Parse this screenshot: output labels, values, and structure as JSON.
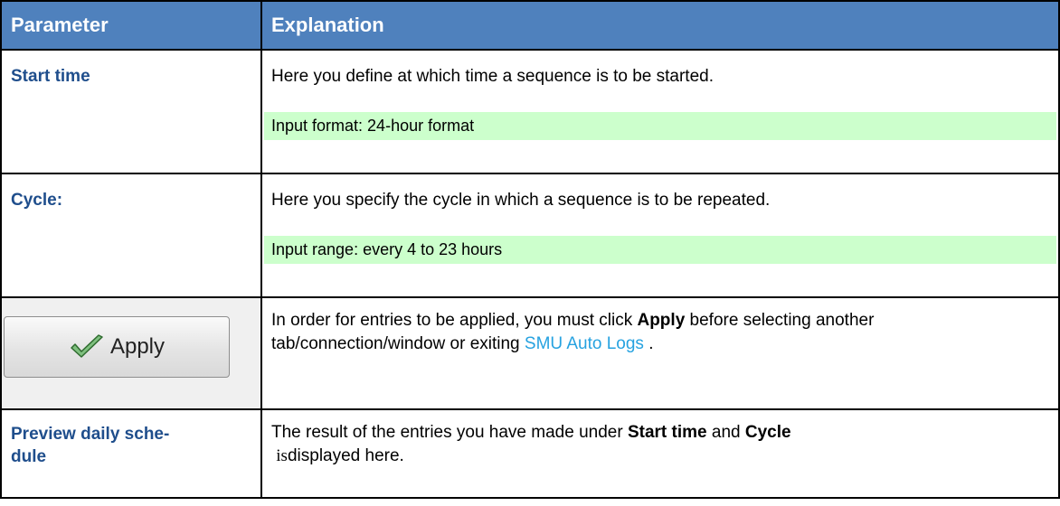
{
  "header": {
    "col1": "Parameter",
    "col2": "Explanation"
  },
  "rows": [
    {
      "param": "Start time",
      "text": "Here you define at which time a sequence is to be started.",
      "hint": "Input format: 24-hour format"
    },
    {
      "param": "Cycle:",
      "text": "Here you specify the cycle in which a sequence is to be repeated.",
      "hint": "Input range: every 4 to 23 hours"
    },
    {
      "button_label": "Apply",
      "button_icon": "checkmark-icon",
      "text_1": "In order for entries to be applied, you must click ",
      "text_bold": "Apply",
      "text_2": " before selecting another tab/connection/window or exiting ",
      "link": "SMU Auto Logs",
      "text_3": " ."
    },
    {
      "param": "Preview daily sche-dule",
      "param_line1": "Preview daily sche-",
      "param_line2": "dule",
      "text_1": "The result of the entries you have made under ",
      "bold_1": "Start time",
      "text_2": " and ",
      "bold_2": "Cycle",
      "text_3": "is",
      "text_4": "displayed here."
    }
  ],
  "colors": {
    "header_bg": "#4f81bd",
    "param_text": "#1f4e8c",
    "hint_bg": "#ccffcc",
    "link": "#26a2e0"
  }
}
